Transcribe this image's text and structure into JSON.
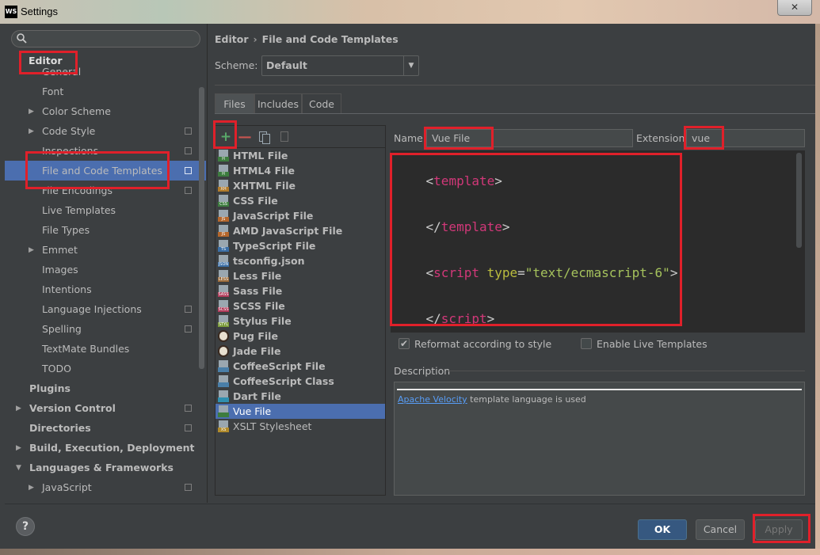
{
  "window": {
    "logo_text": "WS",
    "title": "Settings",
    "close_label": "✕"
  },
  "sidebar": {
    "search_placeholder": "",
    "items": [
      {
        "label": "General",
        "indent": 1,
        "arrow": "",
        "bold": false,
        "copy": false
      },
      {
        "label": "Font",
        "indent": 1,
        "arrow": "",
        "bold": false,
        "copy": false
      },
      {
        "label": "Color Scheme",
        "indent": 1,
        "arrow": "▶",
        "bold": false,
        "copy": false
      },
      {
        "label": "Code Style",
        "indent": 1,
        "arrow": "▶",
        "bold": false,
        "copy": true
      },
      {
        "label": "Inspections",
        "indent": 1,
        "arrow": "",
        "bold": false,
        "copy": true
      },
      {
        "label": "File and Code Templates",
        "indent": 1,
        "arrow": "",
        "bold": false,
        "copy": true,
        "selected": true
      },
      {
        "label": "File Encodings",
        "indent": 1,
        "arrow": "",
        "bold": false,
        "copy": true
      },
      {
        "label": "Live Templates",
        "indent": 1,
        "arrow": "",
        "bold": false,
        "copy": false
      },
      {
        "label": "File Types",
        "indent": 1,
        "arrow": "",
        "bold": false,
        "copy": false
      },
      {
        "label": "Emmet",
        "indent": 1,
        "arrow": "▶",
        "bold": false,
        "copy": false
      },
      {
        "label": "Images",
        "indent": 1,
        "arrow": "",
        "bold": false,
        "copy": false
      },
      {
        "label": "Intentions",
        "indent": 1,
        "arrow": "",
        "bold": false,
        "copy": false
      },
      {
        "label": "Language Injections",
        "indent": 1,
        "arrow": "",
        "bold": false,
        "copy": true
      },
      {
        "label": "Spelling",
        "indent": 1,
        "arrow": "",
        "bold": false,
        "copy": true
      },
      {
        "label": "TextMate Bundles",
        "indent": 1,
        "arrow": "",
        "bold": false,
        "copy": false
      },
      {
        "label": "TODO",
        "indent": 1,
        "arrow": "",
        "bold": false,
        "copy": false
      },
      {
        "label": "Plugins",
        "indent": 0,
        "arrow": "",
        "bold": true,
        "copy": false
      },
      {
        "label": "Version Control",
        "indent": 0,
        "arrow": "▶",
        "bold": true,
        "copy": true
      },
      {
        "label": "Directories",
        "indent": 0,
        "arrow": "",
        "bold": true,
        "copy": true
      },
      {
        "label": "Build, Execution, Deployment",
        "indent": 0,
        "arrow": "▶",
        "bold": true,
        "copy": false
      },
      {
        "label": "Languages & Frameworks",
        "indent": 0,
        "arrow": "▼",
        "bold": true,
        "copy": false
      },
      {
        "label": "JavaScript",
        "indent": 1,
        "arrow": "▶",
        "bold": false,
        "copy": true
      }
    ],
    "editor_header": "Editor"
  },
  "breadcrumb": {
    "parent": "Editor",
    "separator": "›",
    "current": "File and Code Templates"
  },
  "scheme": {
    "label": "Scheme:",
    "value": "Default"
  },
  "tabs": [
    "Files",
    "Includes",
    "Code"
  ],
  "toolbar": {
    "add": "+",
    "remove": "—"
  },
  "templates": [
    {
      "name": "HTML File",
      "icon": "html-file-icon",
      "band": "#3d7c3f",
      "tag": "H",
      "bold": true
    },
    {
      "name": "HTML4 File",
      "icon": "html4-file-icon",
      "band": "#3d7c3f",
      "tag": "H",
      "bold": true
    },
    {
      "name": "XHTML File",
      "icon": "xhtml-file-icon",
      "band": "#b07b2b",
      "tag": "XH",
      "bold": true
    },
    {
      "name": "CSS File",
      "icon": "css-file-icon",
      "band": "#3d7c3f",
      "tag": "CSS",
      "bold": true
    },
    {
      "name": "JavaScript File",
      "icon": "javascript-file-icon",
      "band": "#b4662b",
      "tag": "JS",
      "bold": true
    },
    {
      "name": "AMD JavaScript File",
      "icon": "amd-javascript-file-icon",
      "band": "#b4662b",
      "tag": "JS",
      "bold": true
    },
    {
      "name": "TypeScript File",
      "icon": "typescript-file-icon",
      "band": "#3a6ea5",
      "tag": "TS",
      "bold": true
    },
    {
      "name": "tsconfig.json",
      "icon": "tsconfig-file-icon",
      "band": "#3a6ea5",
      "tag": "JSON",
      "bold": true
    },
    {
      "name": "Less File",
      "icon": "less-file-icon",
      "band": "#9b6b3a",
      "tag": "LESS",
      "bold": true
    },
    {
      "name": "Sass File",
      "icon": "sass-file-icon",
      "band": "#b03a5a",
      "tag": "SASS",
      "bold": true
    },
    {
      "name": "SCSS File",
      "icon": "scss-file-icon",
      "band": "#b03a5a",
      "tag": "SCSS",
      "bold": true
    },
    {
      "name": "Stylus File",
      "icon": "stylus-file-icon",
      "band": "#7a9a3a",
      "tag": "STYL",
      "bold": true
    },
    {
      "name": "Pug File",
      "icon": "pug-file-icon",
      "band": "#5a3a2a",
      "tag": "",
      "bold": true,
      "round": true
    },
    {
      "name": "Jade File",
      "icon": "jade-file-icon",
      "band": "#5a3a2a",
      "tag": "",
      "bold": true,
      "round": true
    },
    {
      "name": "CoffeeScript File",
      "icon": "coffeescript-file-icon",
      "band": "#4a7fa8",
      "tag": "",
      "bold": true
    },
    {
      "name": "CoffeeScript Class",
      "icon": "coffeescript-class-icon",
      "band": "#4a7fa8",
      "tag": "",
      "bold": true
    },
    {
      "name": "Dart File",
      "icon": "dart-file-icon",
      "band": "#2f8fb0",
      "tag": "",
      "bold": true
    },
    {
      "name": "Vue File",
      "icon": "vue-file-icon",
      "band": "#3d7c3f",
      "tag": "",
      "bold": false,
      "selected": true
    },
    {
      "name": "XSLT Stylesheet",
      "icon": "xslt-file-icon",
      "band": "#b08a2b",
      "tag": "XS",
      "bold": false
    }
  ],
  "editor": {
    "name_label": "Name:",
    "name_value": "Vue File",
    "extension_label": "Extension:",
    "extension_value": "vue",
    "code": [
      [
        "<",
        "template",
        ">"
      ],
      [
        "</",
        "template",
        ">"
      ],
      [
        "<",
        "script",
        " ",
        "type",
        "=",
        "\"text/ecmascript-6\"",
        ">"
      ],
      [
        "</",
        "script",
        ">"
      ]
    ],
    "reformat_label": "Reformat according to style",
    "reformat_checked": true,
    "live_templates_label": "Enable Live Templates",
    "live_templates_checked": false,
    "description_title": "Description",
    "description_link": "Apache Velocity",
    "description_text": " template language is used"
  },
  "buttons": {
    "help": "?",
    "ok": "OK",
    "cancel": "Cancel",
    "apply": "Apply"
  },
  "colors": {
    "selection": "#4b6eaf",
    "annotation": "#e0202a",
    "tag_name": "#d23879",
    "attr_name": "#bbbd3e",
    "attr_value": "#a5c25c"
  }
}
